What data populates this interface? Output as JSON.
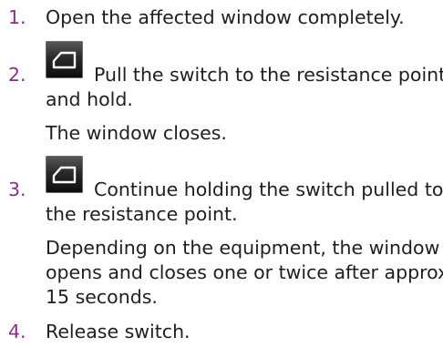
{
  "steps": [
    {
      "number": "1.",
      "lines": [
        "Open the affected window completely."
      ]
    },
    {
      "number": "2.",
      "icon": "window-switch-icon",
      "lines": [
        "Pull the switch to the resistance point",
        "and hold."
      ],
      "note": [
        "The window closes."
      ]
    },
    {
      "number": "3.",
      "icon": "window-switch-icon",
      "lines": [
        "Continue holding the switch pulled to",
        "the resistance point."
      ],
      "note": [
        "Depending on the equipment, the window",
        "opens and closes one or twice after approx.",
        "15 seconds."
      ]
    },
    {
      "number": "4.",
      "lines": [
        "Release switch."
      ]
    }
  ],
  "colors": {
    "step_number": "#8a2f8a",
    "text": "#1e1e1e",
    "icon_background": "#1a1a1a",
    "icon_symbol": "#ffffff"
  }
}
